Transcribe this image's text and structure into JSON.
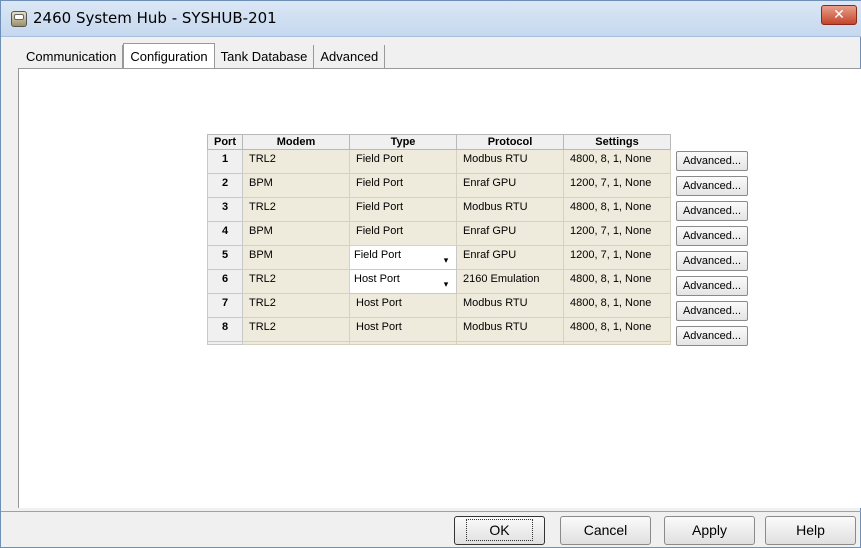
{
  "window": {
    "title": "2460 System Hub  - SYSHUB-201",
    "close_label": "✕"
  },
  "tabs": [
    {
      "label": "Communication",
      "active": false
    },
    {
      "label": "Configuration",
      "active": true
    },
    {
      "label": "Tank Database",
      "active": false
    },
    {
      "label": "Advanced",
      "active": false
    }
  ],
  "table": {
    "headers": [
      "Port",
      "Modem",
      "Type",
      "Protocol",
      "Settings"
    ],
    "rows": [
      {
        "port": "1",
        "modem": "TRL2",
        "type": "Field Port",
        "protocol": "Modbus RTU",
        "settings": "4800, 8, 1, None"
      },
      {
        "port": "2",
        "modem": "BPM",
        "type": "Field Port",
        "protocol": "Enraf GPU",
        "settings": "1200, 7, 1, None"
      },
      {
        "port": "3",
        "modem": "TRL2",
        "type": "Field Port",
        "protocol": "Modbus RTU",
        "settings": "4800, 8, 1, None"
      },
      {
        "port": "4",
        "modem": "BPM",
        "type": "Field Port",
        "protocol": "Enraf GPU",
        "settings": "1200, 7, 1, None"
      },
      {
        "port": "5",
        "modem": "BPM",
        "type": "Field Port",
        "protocol": "Enraf GPU",
        "settings": "1200, 7, 1, None"
      },
      {
        "port": "6",
        "modem": "TRL2",
        "type": "Host Port",
        "protocol": "2160 Emulation",
        "settings": "4800, 8, 1, None"
      },
      {
        "port": "7",
        "modem": "TRL2",
        "type": "Host Port",
        "protocol": "Modbus RTU",
        "settings": "4800, 8, 1, None"
      },
      {
        "port": "8",
        "modem": "TRL2",
        "type": "Host Port",
        "protocol": "Modbus RTU",
        "settings": "4800, 8, 1, None"
      }
    ],
    "advanced_label": "Advanced..."
  },
  "buttons": {
    "ok": "OK",
    "cancel": "Cancel",
    "apply": "Apply",
    "help": "Help"
  }
}
